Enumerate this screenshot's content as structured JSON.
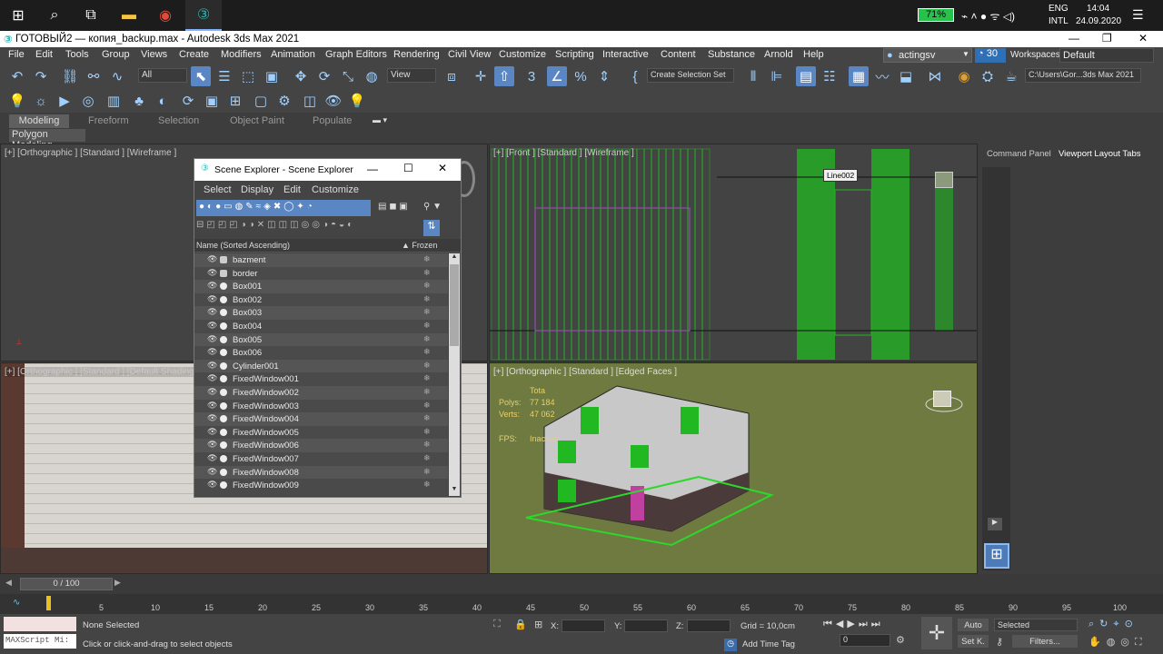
{
  "taskbar": {
    "battery": "71%",
    "lang": "ENG",
    "layout": "INTL",
    "time": "14:04",
    "date": "24.09.2020"
  },
  "window": {
    "title": "ГОТОВЫЙ2 — копия_backup.max - Autodesk 3ds Max 2021"
  },
  "menu": [
    "File",
    "Edit",
    "Tools",
    "Group",
    "Views",
    "Create",
    "Modifiers",
    "Animation",
    "Graph Editors",
    "Rendering",
    "Civil View",
    "Customize",
    "Scripting",
    "Interactive",
    "Content",
    "Substance",
    "Arnold",
    "Help"
  ],
  "account": {
    "user": "actingsv",
    "badge": "30",
    "workspaces_label": "Workspaces:",
    "workspace": "Default"
  },
  "toolbar": {
    "filter": "All",
    "view": "View",
    "selection_set": "Create Selection Set",
    "path": "C:\\Users\\Gor...3ds Max 2021"
  },
  "ribbon": {
    "tabs": [
      "Modeling",
      "Freeform",
      "Selection",
      "Object Paint",
      "Populate"
    ],
    "sub": "Polygon Modeling"
  },
  "viewports": {
    "top_left": "[+] [Orthographic ] [Standard ] [Wireframe ]",
    "top_right": "[+] [Front ] [Standard ] [Wireframe ]",
    "bottom_left": "[+] [Orthographic ] [Standard ] [Default Shading ]",
    "bottom_right": "[+] [Orthographic ] [Standard ] [Edged Faces ]",
    "tooltip": "Line002",
    "stats": {
      "total_label": "Tota",
      "polys_label": "Polys:",
      "polys": "77 184",
      "verts_label": "Verts:",
      "verts": "47 062",
      "fps_label": "FPS:",
      "fps": "Inactive"
    }
  },
  "command_panel": {
    "tabs": [
      "Command Panel",
      "Viewport Layout Tabs"
    ]
  },
  "scene_explorer": {
    "title": "Scene Explorer - Scene Explorer",
    "menu": [
      "Select",
      "Display",
      "Edit",
      "Customize"
    ],
    "col_name": "Name (Sorted Ascending)",
    "col_frozen": "▲ Frozen",
    "rows": [
      "bazment",
      "border",
      "Box001",
      "Box002",
      "Box003",
      "Box004",
      "Box005",
      "Box006",
      "Cylinder001",
      "FixedWindow001",
      "FixedWindow002",
      "FixedWindow003",
      "FixedWindow004",
      "FixedWindow005",
      "FixedWindow006",
      "FixedWindow007",
      "FixedWindow008",
      "FixedWindow009"
    ]
  },
  "timeline": {
    "frame": "0 / 100",
    "ticks": [
      "5",
      "10",
      "15",
      "20",
      "25",
      "30",
      "35",
      "40",
      "45",
      "50",
      "55",
      "60",
      "65",
      "70",
      "75",
      "80",
      "85",
      "90",
      "95",
      "100"
    ]
  },
  "status": {
    "maxscript": "MAXScript Mi:",
    "selected": "None Selected",
    "hint": "Click or click-and-drag to select objects",
    "x": "X:",
    "y": "Y:",
    "z": "Z:",
    "grid": "Grid = 10,0cm",
    "add_time_tag": "Add Time Tag",
    "auto": "Auto",
    "set_k": "Set K.",
    "sel_mode": "Selected",
    "filters": "Filters...",
    "frame_val": "0"
  },
  "colors": {
    "accent": "#5a87c4",
    "wire_green": "#1fb81f",
    "bg": "#3b3b3b"
  }
}
